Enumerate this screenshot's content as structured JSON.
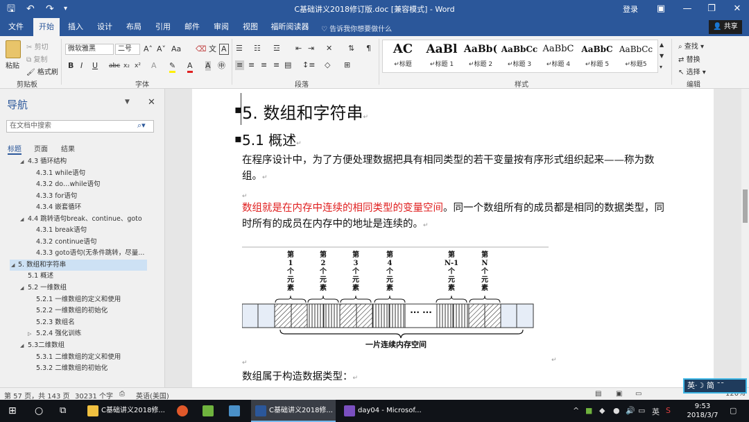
{
  "app": {
    "title": "C基础讲义2018修订版.doc [兼容模式] - Word",
    "login": "登录"
  },
  "tabs": [
    {
      "label": "文件"
    },
    {
      "label": "开始"
    },
    {
      "label": "插入"
    },
    {
      "label": "设计"
    },
    {
      "label": "布局"
    },
    {
      "label": "引用"
    },
    {
      "label": "邮件"
    },
    {
      "label": "审阅"
    },
    {
      "label": "视图"
    },
    {
      "label": "福昕阅读器"
    }
  ],
  "tellme": "告诉我你想要做什么",
  "share": "共享",
  "ribbon": {
    "clipboard": {
      "paste": "粘贴",
      "cut": "剪切",
      "copy": "复制",
      "format_painter": "格式刷",
      "label": "剪贴板"
    },
    "font": {
      "name": "微软雅黑",
      "size": "二号",
      "label": "字体"
    },
    "paragraph": {
      "label": "段落"
    },
    "styles": {
      "label": "样式",
      "items": [
        {
          "preview": "AC",
          "name": "标题"
        },
        {
          "preview": "AaBl",
          "name": "标题 1"
        },
        {
          "preview": "AaBb(",
          "name": "标题 2"
        },
        {
          "preview": "AaBbCc",
          "name": "标题 3"
        },
        {
          "preview": "AaBbC",
          "name": "标题 4"
        },
        {
          "preview": "AaBbC",
          "name": "标题 5"
        },
        {
          "preview": "AaBbCc",
          "name": "标题5"
        }
      ]
    },
    "editing": {
      "find": "查找",
      "replace": "替换",
      "select": "选择",
      "label": "编辑"
    }
  },
  "nav": {
    "title": "导航",
    "search_placeholder": "在文档中搜索",
    "tabs": [
      "标题",
      "页面",
      "结果"
    ],
    "items": [
      {
        "label": "4.3 循环结构"
      },
      {
        "label": "4.3.1 while语句"
      },
      {
        "label": "4.3.2 do…while语句"
      },
      {
        "label": "4.3.3 for语句"
      },
      {
        "label": "4.3.4 嵌套循环"
      },
      {
        "label": "4.4 跳转语句break、continue、goto"
      },
      {
        "label": "4.3.1 break语句"
      },
      {
        "label": "4.3.2 continue语句"
      },
      {
        "label": "4.3.3 goto语句(无条件跳转，尽量..."
      },
      {
        "label": "5. 数组和字符串"
      },
      {
        "label": "5.1 概述"
      },
      {
        "label": "5.2 一维数组"
      },
      {
        "label": "5.2.1 一维数组的定义和使用"
      },
      {
        "label": "5.2.2 一维数组的初始化"
      },
      {
        "label": "5.2.3 数组名"
      },
      {
        "label": "5.2.4 强化训练"
      },
      {
        "label": "5.3二维数组"
      },
      {
        "label": "5.3.1 二维数组的定义和使用"
      },
      {
        "label": "5.3.2 二维数组的初始化"
      }
    ]
  },
  "document": {
    "h1": "5. 数组和字符串",
    "h2": "5.1 概述",
    "para1": "在程序设计中，为了方便处理数据把具有相同类型的若干变量按有序形式组织起来——称为数组。",
    "para2_red": "数组就是在内存中连续的相同类型的变量空间",
    "para2_rest": "。同一个数组所有的成员都是相同的数据类型，同时所有的成员在内存中的地址是连续的。",
    "para3": "数组属于构造数据类型：",
    "diagram": {
      "labels": [
        [
          "第",
          "1",
          "个",
          "元",
          "素"
        ],
        [
          "第",
          "2",
          "个",
          "元",
          "素"
        ],
        [
          "第",
          "3",
          "个",
          "元",
          "素"
        ],
        [
          "第",
          "4",
          "个",
          "元",
          "素"
        ],
        [
          "第",
          "N-1",
          "个",
          "元",
          "素"
        ],
        [
          "第",
          "N",
          "个",
          "元",
          "素"
        ]
      ],
      "dots": "... ...",
      "caption": "一片连续内存空间"
    }
  },
  "status": {
    "page": "第 57 页，共 143 页",
    "words": "30231 个字",
    "lang": "英语(美国)",
    "zoom": "120%"
  },
  "taskbar": {
    "items": [
      {
        "label": "C基础讲义2018修..."
      },
      {
        "label": "C基础讲义2018修..."
      },
      {
        "label": "day04 - Microsof..."
      }
    ],
    "lang": "英",
    "time": "9:53",
    "date": "2018/3/7"
  },
  "ime": {
    "text": "英·☽ 简 ¯¯"
  }
}
